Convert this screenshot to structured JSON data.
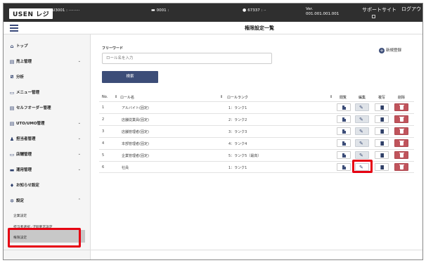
{
  "topbar": {
    "logo": "USEN レジ",
    "store_id": "U3001 : ·········",
    "terminal": "0001 :",
    "user": "67337 : ··",
    "ver_label": "Ver.",
    "ver_value": "001.001.001.001",
    "support": "サポートサイト",
    "logout": "ログアウト"
  },
  "page_title": "権限設定一覧",
  "sidebar": {
    "items": [
      {
        "label": "トップ",
        "icon": "home-icon",
        "glyph": "⌂"
      },
      {
        "label": "売上管理",
        "icon": "receipt-icon",
        "glyph": "▤",
        "chevron": "⌄"
      },
      {
        "label": "分析",
        "icon": "chart-icon",
        "glyph": "⧄"
      },
      {
        "label": "メニュー管理",
        "icon": "menu-book-icon",
        "glyph": "▭"
      },
      {
        "label": "セルフオーダー管理",
        "icon": "tablet-icon",
        "glyph": "▤"
      },
      {
        "label": "UTO/UMO管理",
        "icon": "store-icon",
        "glyph": "▤",
        "chevron": "⌄"
      },
      {
        "label": "担当者管理",
        "icon": "staff-icon",
        "glyph": "♟",
        "chevron": "⌄"
      },
      {
        "label": "店舗管理",
        "icon": "shop-icon",
        "glyph": "▭",
        "chevron": "⌄"
      },
      {
        "label": "運用管理",
        "icon": "operation-icon",
        "glyph": "▬",
        "chevron": "⌄"
      },
      {
        "label": "お知らせ設定",
        "icon": "bell-icon",
        "glyph": "♦"
      },
      {
        "label": "設定",
        "icon": "gear-icon",
        "glyph": "✲",
        "chevron": "⌃"
      }
    ],
    "sub_items": [
      "企業設定",
      "担当者選択／PW要求設定",
      "権限設定"
    ]
  },
  "search": {
    "label": "フリーワード",
    "placeholder": "ロール名を入力",
    "button": "検索"
  },
  "new_registration": "新規登録",
  "table": {
    "headers": {
      "no": "No.",
      "role_name": "ロール名",
      "role_rank": "ロールランク",
      "view": "閲覧",
      "edit": "編集",
      "copy": "複写",
      "delete": "削除"
    },
    "rows": [
      {
        "no": "1",
        "name": "アルバイト(固定)",
        "rank": "1：ランク1"
      },
      {
        "no": "2",
        "name": "店舗従業員(固定)",
        "rank": "2：ランク2"
      },
      {
        "no": "3",
        "name": "店舗管理者(固定)",
        "rank": "3：ランク3"
      },
      {
        "no": "4",
        "name": "本部管理者(固定)",
        "rank": "4：ランク4"
      },
      {
        "no": "5",
        "name": "企業管理者(固定)",
        "rank": "5：ランク5（最高）"
      },
      {
        "no": "6",
        "name": "社員",
        "rank": "1：ランク1"
      }
    ]
  },
  "colors": {
    "topbar": "#2f2f2f",
    "accent": "#3c4d78",
    "delete": "#c0545c",
    "highlight": "#e60012"
  }
}
